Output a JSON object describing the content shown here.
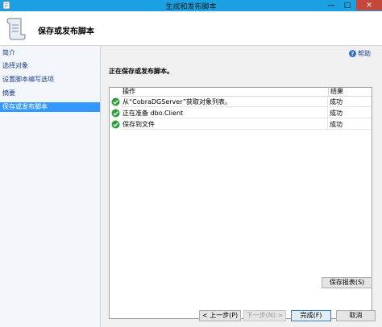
{
  "window": {
    "title": "生成和发布脚本"
  },
  "banner": {
    "heading": "保存或发布脚本"
  },
  "sidebar": {
    "items": [
      {
        "label": "简介"
      },
      {
        "label": "选择对象"
      },
      {
        "label": "设置脚本编写选项"
      },
      {
        "label": "摘要"
      },
      {
        "label": "保存或发布脚本"
      }
    ],
    "active_index": 4
  },
  "content": {
    "help_label": "帮助",
    "section_title": "正在保存或发布脚本。",
    "grid": {
      "columns": {
        "operation": "操作",
        "result": "结果"
      },
      "rows": [
        {
          "operation": "从“CobraDGServer”获取对象列表。",
          "result": "成功",
          "status": "success"
        },
        {
          "operation": "正在准备 dbo.Client",
          "result": "成功",
          "status": "success"
        },
        {
          "operation": "保存到文件",
          "result": "成功",
          "status": "success"
        }
      ]
    },
    "save_report_label": "保存报表(S)"
  },
  "footer": {
    "prev_label": "< 上一步(P)",
    "next_label": "下一步(N) >",
    "finish_label": "完成(F)",
    "cancel_label": "取消"
  },
  "colors": {
    "titlebar": "#1ba1e2",
    "active_nav": "#3399ff",
    "success": "#2e9e3a",
    "close": "#c7463c"
  }
}
